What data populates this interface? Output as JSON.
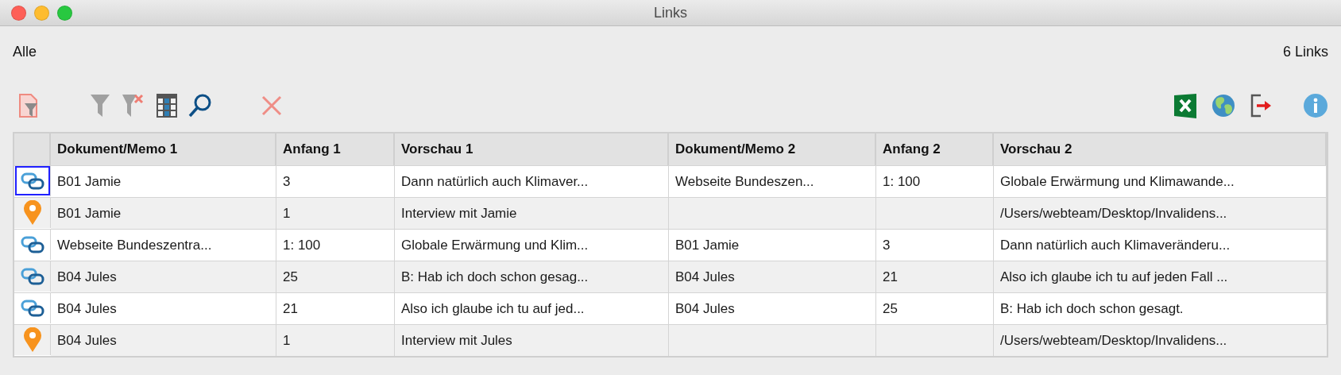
{
  "window": {
    "title": "Links"
  },
  "header": {
    "filter_label": "Alle",
    "count": "6 Links"
  },
  "table": {
    "columns": [
      "Dokument/Memo 1",
      "Anfang 1",
      "Vorschau 1",
      "Dokument/Memo 2",
      "Anfang 2",
      "Vorschau 2"
    ],
    "rows": [
      {
        "kind": "link",
        "selected": true,
        "cells": [
          "B01 Jamie",
          "3",
          "Dann natürlich auch Klimaver...",
          "Webseite Bundeszen...",
          "1: 100",
          "Globale Erwärmung und Klimawande..."
        ]
      },
      {
        "kind": "geolink",
        "selected": false,
        "cells": [
          "B01 Jamie",
          "1",
          "Interview mit Jamie",
          "",
          "",
          "/Users/webteam/Desktop/Invalidens..."
        ]
      },
      {
        "kind": "link",
        "selected": false,
        "cells": [
          "Webseite Bundeszentra...",
          "1: 100",
          "Globale Erwärmung und Klim...",
          "B01 Jamie",
          "3",
          "Dann natürlich auch Klimaveränderu..."
        ]
      },
      {
        "kind": "link",
        "selected": false,
        "cells": [
          "B04 Jules",
          "25",
          "B: Hab ich doch schon gesag...",
          "B04 Jules",
          "21",
          "Also ich glaube ich tu auf jeden Fall ..."
        ]
      },
      {
        "kind": "link",
        "selected": false,
        "cells": [
          "B04 Jules",
          "21",
          "Also ich glaube ich tu auf jed...",
          "B04 Jules",
          "25",
          "B: Hab ich doch schon gesagt."
        ]
      },
      {
        "kind": "geolink",
        "selected": false,
        "cells": [
          "B04 Jules",
          "1",
          "Interview mit Jules",
          "",
          "",
          "/Users/webteam/Desktop/Invalidens..."
        ]
      }
    ]
  }
}
